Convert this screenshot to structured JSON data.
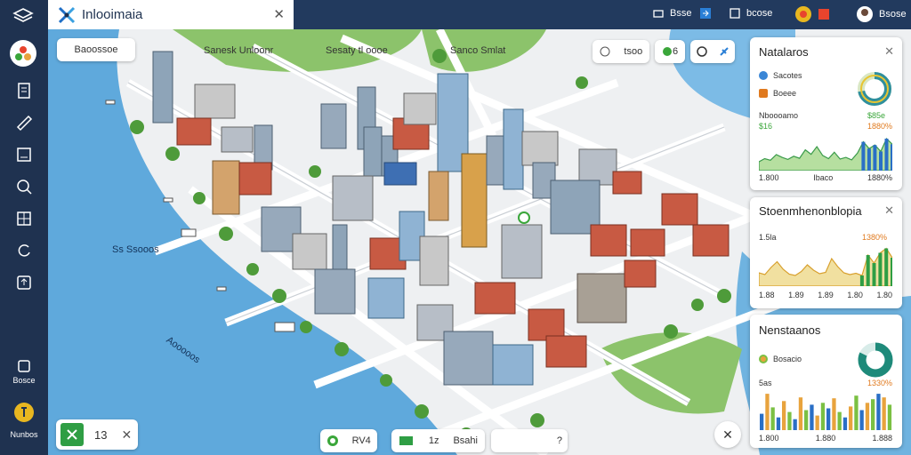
{
  "app": {
    "title": "Inlooimaia",
    "close": "✕"
  },
  "topbar": {
    "items": [
      {
        "label": "Bsse"
      },
      {
        "label": "bcose"
      },
      {
        "label": "Bsose"
      }
    ]
  },
  "sidebar": {
    "bottom_items": [
      {
        "label": "Bosce"
      },
      {
        "label": "Nunbos"
      }
    ]
  },
  "map": {
    "search_chip": {
      "label": "Baoossoe"
    },
    "top_chips": [
      {
        "label": "tsoo"
      },
      {
        "label": "6"
      }
    ],
    "labels": [
      {
        "text": "Sanesk Unloonr"
      },
      {
        "text": "Sesaty tl oooe"
      },
      {
        "text": "Sanco Smlat"
      },
      {
        "text": "Ss Ssooos"
      },
      {
        "text": "Aooooos"
      }
    ],
    "bottom_left": {
      "label": "13"
    },
    "bottom_bar": [
      {
        "label": "RV4"
      },
      {
        "label": "1z"
      },
      {
        "label": "Bsahi"
      },
      {
        "label": "?"
      }
    ]
  },
  "panels": [
    {
      "title": "Natalaros",
      "legend": [
        {
          "label": "Sacotes",
          "color": "#3a86d6"
        },
        {
          "label": "Boeee",
          "color": "#e07a1f"
        }
      ],
      "sub_left": "Nboooamo",
      "sub_left_value": "$16",
      "sub_right": "$85e",
      "sub_right_value": "1880%",
      "axis": [
        "1.800",
        "Ibaco",
        "1880%"
      ],
      "chart_values": [
        22,
        30,
        26,
        40,
        33,
        28,
        36,
        31,
        52,
        41,
        60,
        38,
        30,
        46,
        29,
        33,
        27,
        44,
        72,
        55,
        64,
        48,
        80,
        66
      ],
      "donut": 0.72
    },
    {
      "title": "Stoenmhenonblopia",
      "sub_left": "1.5la",
      "sub_right": "1380%",
      "axis": [
        "1.88",
        "1.89",
        "1.89",
        "1.80",
        "1.80"
      ],
      "chart_values": [
        30,
        26,
        42,
        55,
        38,
        27,
        24,
        33,
        48,
        36,
        28,
        31,
        62,
        44,
        30,
        26,
        29,
        24,
        70,
        52,
        75,
        85,
        64
      ],
      "colors": [
        "#7bc043",
        "#e8a33d"
      ]
    },
    {
      "title": "Nenstaanos",
      "legend": [
        {
          "label": "Bosacio",
          "color": "#e8a33d"
        }
      ],
      "sub_left": "5as",
      "sub_right": "1330%",
      "axis": [
        "1.800",
        "1.880",
        "1.888"
      ],
      "chart_values": [
        18,
        40,
        25,
        14,
        32,
        20,
        12,
        36,
        22,
        28,
        16,
        30,
        24,
        35,
        20,
        14,
        26,
        38,
        22,
        30,
        34,
        40,
        36,
        28
      ],
      "donut": 0.82
    }
  ]
}
